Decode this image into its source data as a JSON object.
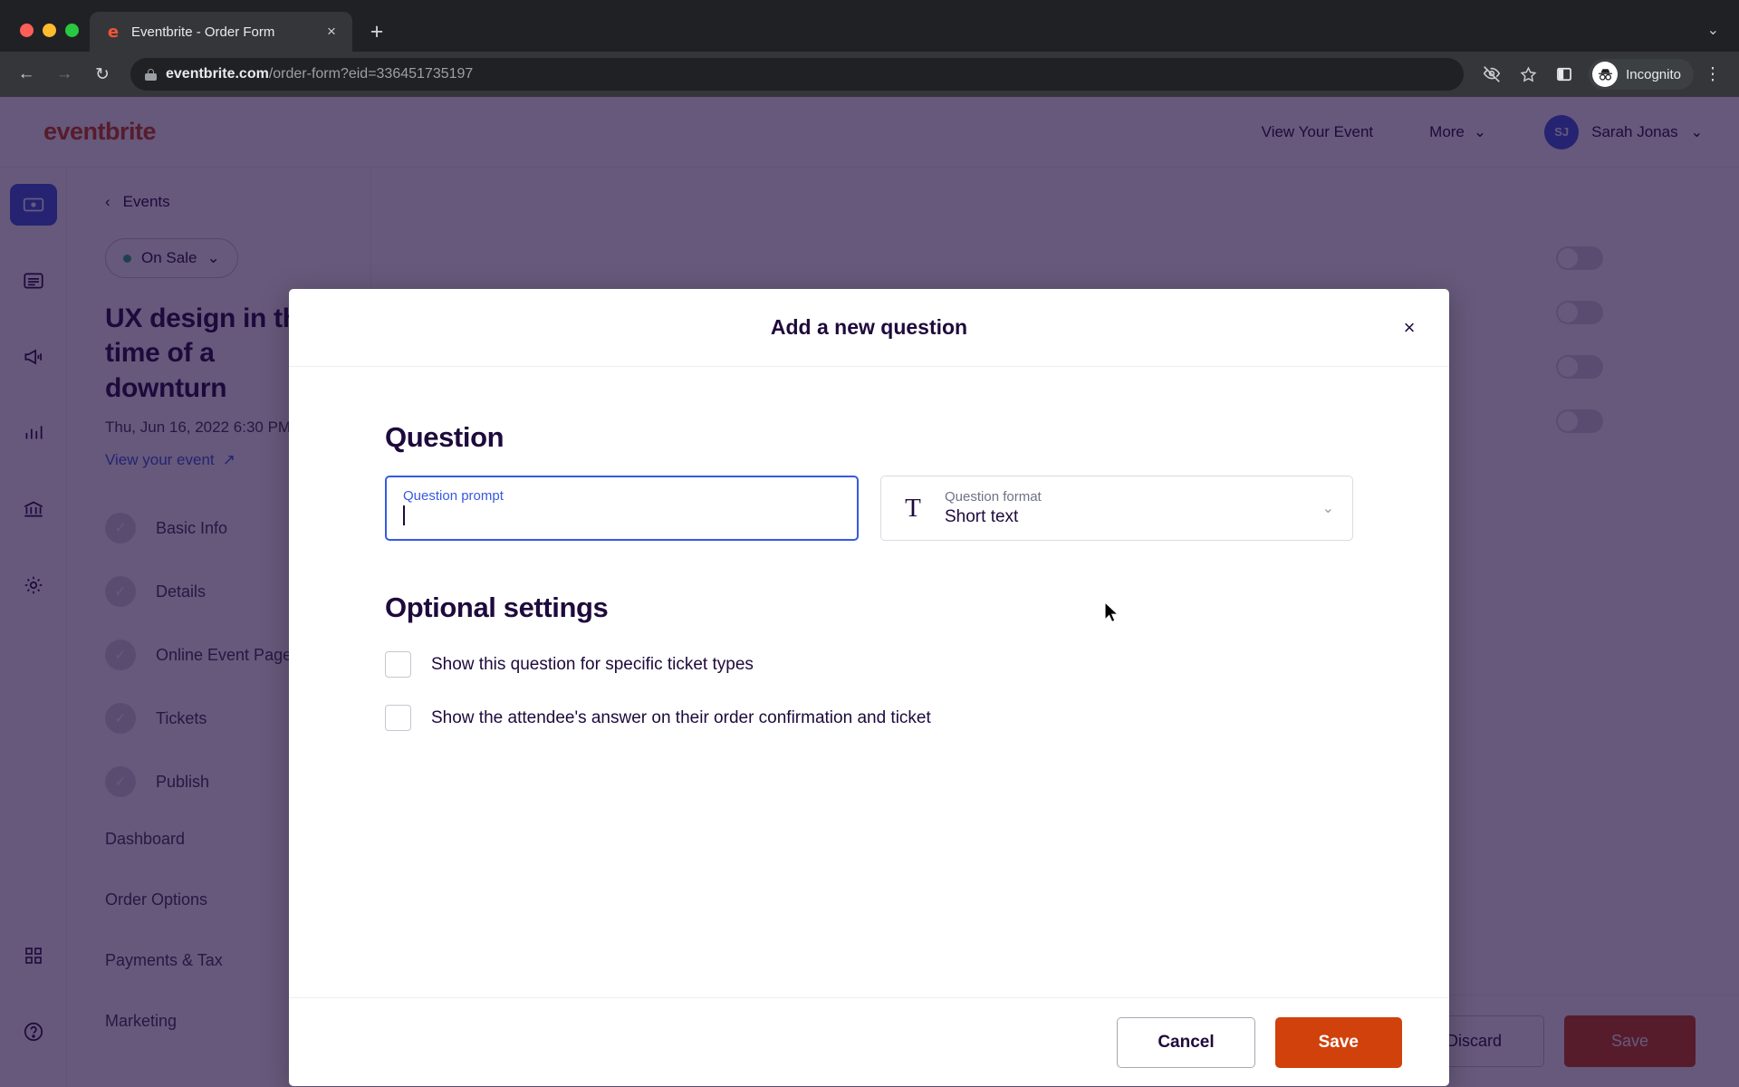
{
  "browser": {
    "tab": {
      "title": "Eventbrite - Order Form",
      "favicon": "e",
      "close_icon": "×"
    },
    "new_tab_icon": "+",
    "tabstrip_chevron_icon": "⌄",
    "back_icon": "←",
    "forward_icon": "→",
    "reload_icon": "↻",
    "url_host": "eventbrite.com",
    "url_path": "/order-form?eid=336451735197",
    "eye_off_icon": "eye-off-icon",
    "star_icon": "☆",
    "side_panel_icon": "side-panel-icon",
    "incognito_label": "Incognito",
    "menu_icon": "⋮"
  },
  "app_header": {
    "logo": "eventbrite",
    "view_event_link": "View Your Event",
    "more_label": "More",
    "more_chevron": "⌄",
    "avatar_initials": "SJ",
    "user_name": "Sarah Jonas",
    "user_chevron": "⌄"
  },
  "rail": {
    "items": [
      {
        "name": "events-icon",
        "active": true
      },
      {
        "name": "orders-icon",
        "active": false
      },
      {
        "name": "marketing-megaphone-icon",
        "active": false
      },
      {
        "name": "reports-bar-chart-icon",
        "active": false
      },
      {
        "name": "finance-bank-icon",
        "active": false
      },
      {
        "name": "settings-gear-icon",
        "active": false
      },
      {
        "name": "apps-grid-icon",
        "active": false
      },
      {
        "name": "help-icon",
        "active": false
      }
    ]
  },
  "nav": {
    "back_icon": "‹",
    "back_label": "Events",
    "status": "On Sale",
    "status_chevron": "⌄",
    "event_title": "UX design in the time of a downturn",
    "event_date": "Thu, Jun 16, 2022 6:30 PM",
    "view_event_link": "View your event",
    "external_icon": "↗",
    "steps": [
      {
        "label": "Basic Info",
        "check": "✓"
      },
      {
        "label": "Details",
        "check": "✓"
      },
      {
        "label": "Online Event Page",
        "check": "✓"
      },
      {
        "label": "Tickets",
        "check": "✓"
      },
      {
        "label": "Publish",
        "check": "✓"
      }
    ],
    "links": [
      {
        "label": "Dashboard",
        "chevron": ""
      },
      {
        "label": "Order Options",
        "chevron": ""
      },
      {
        "label": "Payments & Tax",
        "chevron": "⌄"
      },
      {
        "label": "Marketing",
        "chevron": ""
      }
    ]
  },
  "page_footer": {
    "discard_label": "Discard",
    "save_label": "Save"
  },
  "modal": {
    "title": "Add a new question",
    "close_icon": "×",
    "question_section_title": "Question",
    "prompt_label": "Question prompt",
    "prompt_value": "",
    "format_icon": "T",
    "format_label": "Question format",
    "format_value": "Short text",
    "format_chevron": "⌄",
    "optional_section_title": "Optional settings",
    "checkboxes": [
      {
        "label": "Show this question for specific ticket types",
        "checked": false
      },
      {
        "label": "Show the attendee's answer on their order confirmation and ticket",
        "checked": false
      }
    ],
    "cancel_label": "Cancel",
    "save_label": "Save"
  },
  "colors": {
    "brand_orange": "#d1410c",
    "accent_blue": "#3659e3",
    "ink": "#1e0a3c",
    "status_green": "#26b07a"
  }
}
